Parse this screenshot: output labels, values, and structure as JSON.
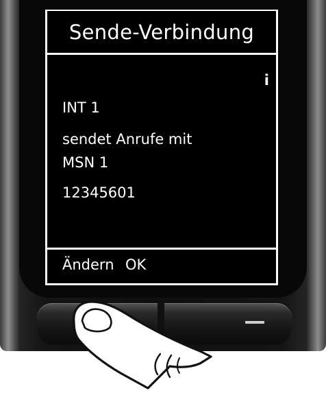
{
  "screen": {
    "title": "Sende-Verbindung",
    "info_icon": "i",
    "lines": [
      "INT  1",
      "sendet Anrufe mit",
      "MSN 1",
      "12345601"
    ],
    "softkeys": {
      "left_label": "Ändern",
      "right_label": "OK"
    }
  },
  "icons": {
    "info": "info-icon",
    "finger": "pointing-finger-icon"
  },
  "colors": {
    "screen_background": "#000000",
    "screen_text": "#ffffff",
    "handset_body": "#101010"
  }
}
